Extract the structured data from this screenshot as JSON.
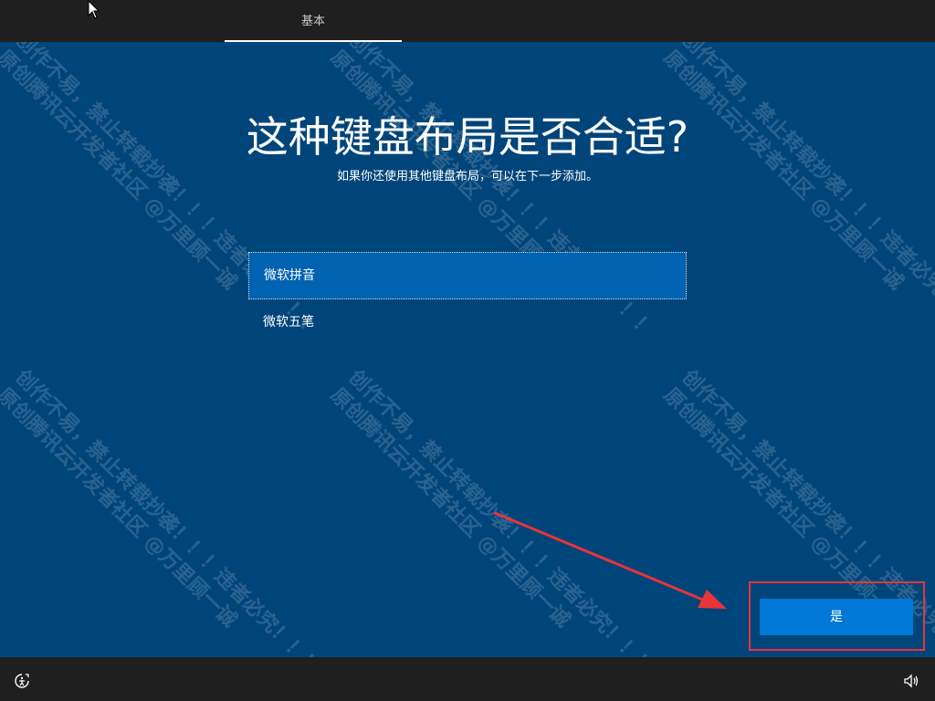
{
  "header": {
    "tab_label": "基本"
  },
  "main": {
    "title": "这种键盘布局是否合适?",
    "subtitle": "如果你还使用其他键盘布局，可以在下一步添加。",
    "layouts": [
      {
        "label": "微软拼音",
        "selected": true
      },
      {
        "label": "微软五笔",
        "selected": false
      }
    ]
  },
  "footer": {
    "yes_label": "是",
    "left_icon": "ease-of-access-icon",
    "right_icon": "volume-icon"
  },
  "watermark": {
    "line1": "创作不易，禁止转载抄袭！！！违者必究！！！",
    "line2": "原创腾讯云开发者社区 @万里顾一诚"
  },
  "colors": {
    "background": "#00457a",
    "bar": "#1f1f1f",
    "selected": "#0063b1",
    "button": "#0078d7",
    "annotation": "#e8343a"
  }
}
